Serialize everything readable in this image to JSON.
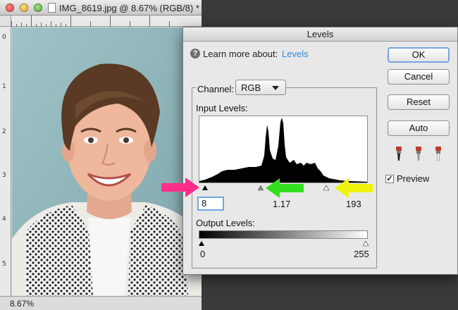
{
  "document": {
    "title": "IMG_8619.jpg @ 8.67% (RGB/8) *",
    "zoom": "8.67%",
    "ruler_numbers": [
      "0",
      "1",
      "2",
      "3",
      "4",
      "5"
    ]
  },
  "dialog": {
    "title": "Levels",
    "learn_more": "Learn more about:",
    "learn_link": "Levels",
    "channel_label": "Channel:",
    "channel_value": "RGB",
    "input_levels_label": "Input Levels:",
    "input_black": "8",
    "input_gamma": "1.17",
    "input_white": "193",
    "output_levels_label": "Output Levels:",
    "output_black": "0",
    "output_white": "255",
    "buttons": {
      "ok": "OK",
      "cancel": "Cancel",
      "reset": "Reset",
      "auto": "Auto"
    },
    "preview_label": "Preview",
    "preview_checked": "✓"
  },
  "colors": {
    "arrow_black_point": "#ff2d8a",
    "arrow_gamma": "#33e01f",
    "arrow_white_point": "#f0f20f",
    "link": "#2e89d6"
  },
  "icons": [
    "help-icon",
    "black-eyedropper-icon",
    "gray-eyedropper-icon",
    "white-eyedropper-icon",
    "chevron-down-icon"
  ]
}
